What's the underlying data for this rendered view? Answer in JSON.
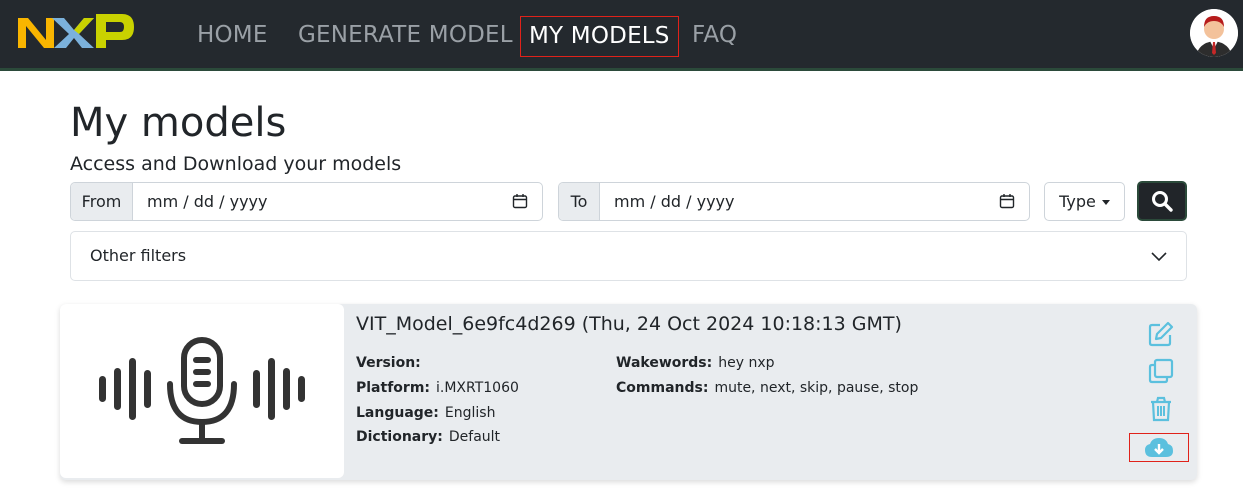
{
  "nav": {
    "logo_text": "NXP",
    "links": [
      {
        "label": "HOME"
      },
      {
        "label": "GENERATE MODEL"
      },
      {
        "label": "MY MODELS"
      },
      {
        "label": "FAQ"
      }
    ]
  },
  "header": {
    "title": "My models",
    "subtitle": "Access and Download your models"
  },
  "filters": {
    "from_label": "From",
    "from_value": "mm / dd / yyyy",
    "to_label": "To",
    "to_value": "mm / dd / yyyy",
    "type_label": "Type",
    "other_filters_label": "Other filters"
  },
  "model": {
    "title": "VIT_Model_6e9fc4d269 (Thu, 24 Oct 2024 10:18:13 GMT)",
    "version_label": "Version:",
    "version_value": "",
    "platform_label": "Platform:",
    "platform_value": "i.MXRT1060",
    "language_label": "Language:",
    "language_value": "English",
    "dictionary_label": "Dictionary:",
    "dictionary_value": "Default",
    "wakewords_label": "Wakewords:",
    "wakewords_value": "hey nxp",
    "commands_label": "Commands:",
    "commands_value": "mute, next, skip, pause, stop"
  },
  "colors": {
    "navbar_bg": "#24292e",
    "active_outline": "#e0221a",
    "action_icon": "#5bc0de",
    "card_bg": "#e9ecef"
  },
  "icons": {
    "calendar": "calendar-icon",
    "search": "search-icon",
    "chevron": "chevron-down-icon",
    "edit": "edit-icon",
    "copy": "copy-icon",
    "delete": "trash-icon",
    "download": "cloud-download-icon",
    "thumbnail": "microphone-waveform-icon"
  }
}
